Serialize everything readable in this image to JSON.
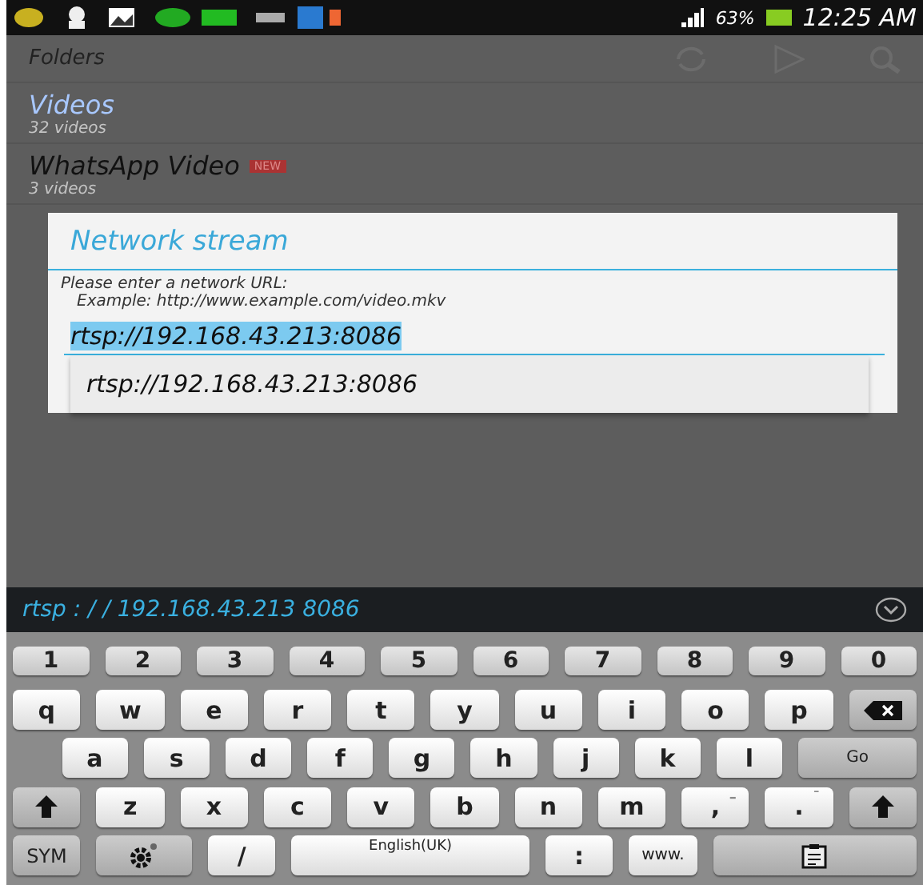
{
  "status_bar": {
    "battery": "63%",
    "time": "12:25 AM"
  },
  "app_bar": {
    "title": "Folders"
  },
  "folders": [
    {
      "name": "Videos",
      "count": "32 videos",
      "selected": true
    },
    {
      "name": "WhatsApp Video",
      "count": "3 videos",
      "selected": false,
      "badge": "NEW"
    }
  ],
  "dialog": {
    "title": "Network stream",
    "prompt": "Please enter a network URL:",
    "example": "Example: http://www.example.com/video.mkv",
    "input": {
      "value": "rtsp://192.168.43.213:8086",
      "highlighted": true
    },
    "suggestions": [
      "rtsp://192.168.43.213:8086"
    ]
  },
  "prediction_bar": {
    "text": "rtsp : / / 192.168.43.213 8086"
  },
  "keyboard": [
    [
      {
        "kind": "num",
        "label": "1"
      },
      {
        "kind": "num",
        "label": "2"
      },
      {
        "kind": "num",
        "label": "3"
      },
      {
        "kind": "num",
        "label": "4"
      },
      {
        "kind": "num",
        "label": "5"
      },
      {
        "kind": "num",
        "label": "6"
      },
      {
        "kind": "num",
        "label": "7"
      },
      {
        "kind": "num",
        "label": "8"
      },
      {
        "kind": "num",
        "label": "9"
      },
      {
        "kind": "num",
        "label": "0"
      }
    ],
    [
      {
        "kind": "char",
        "label": "q"
      },
      {
        "kind": "char",
        "label": "w"
      },
      {
        "kind": "char",
        "label": "e"
      },
      {
        "kind": "char",
        "label": "r"
      },
      {
        "kind": "char",
        "label": "t"
      },
      {
        "kind": "char",
        "label": "y"
      },
      {
        "kind": "char",
        "label": "u"
      },
      {
        "kind": "char",
        "label": "i"
      },
      {
        "kind": "char",
        "label": "o"
      },
      {
        "kind": "char",
        "label": "p"
      },
      {
        "kind": "backspace"
      }
    ],
    [
      {
        "kind": "spacer"
      },
      {
        "kind": "char",
        "label": "a"
      },
      {
        "kind": "char",
        "label": "s"
      },
      {
        "kind": "char",
        "label": "d"
      },
      {
        "kind": "char",
        "label": "f"
      },
      {
        "kind": "char",
        "label": "g"
      },
      {
        "kind": "char",
        "label": "h"
      },
      {
        "kind": "char",
        "label": "j"
      },
      {
        "kind": "char",
        "label": "k"
      },
      {
        "kind": "char",
        "label": "l"
      },
      {
        "kind": "go",
        "label": "Go"
      }
    ],
    [
      {
        "kind": "shift"
      },
      {
        "kind": "char",
        "label": "z"
      },
      {
        "kind": "char",
        "label": "x"
      },
      {
        "kind": "char",
        "label": "c"
      },
      {
        "kind": "char",
        "label": "v"
      },
      {
        "kind": "char",
        "label": "b"
      },
      {
        "kind": "char",
        "label": "n"
      },
      {
        "kind": "char",
        "label": "m"
      },
      {
        "kind": "char",
        "label": ",",
        "hint": "–"
      },
      {
        "kind": "char",
        "label": ".",
        "hint": "¯"
      },
      {
        "kind": "shift"
      }
    ],
    [
      {
        "kind": "func",
        "label": "SYM"
      },
      {
        "kind": "settings"
      },
      {
        "kind": "char",
        "label": "/"
      },
      {
        "kind": "space",
        "label": "English(UK)"
      },
      {
        "kind": "char",
        "label": ":"
      },
      {
        "kind": "small",
        "label": "www."
      },
      {
        "kind": "clipboard"
      }
    ]
  ]
}
